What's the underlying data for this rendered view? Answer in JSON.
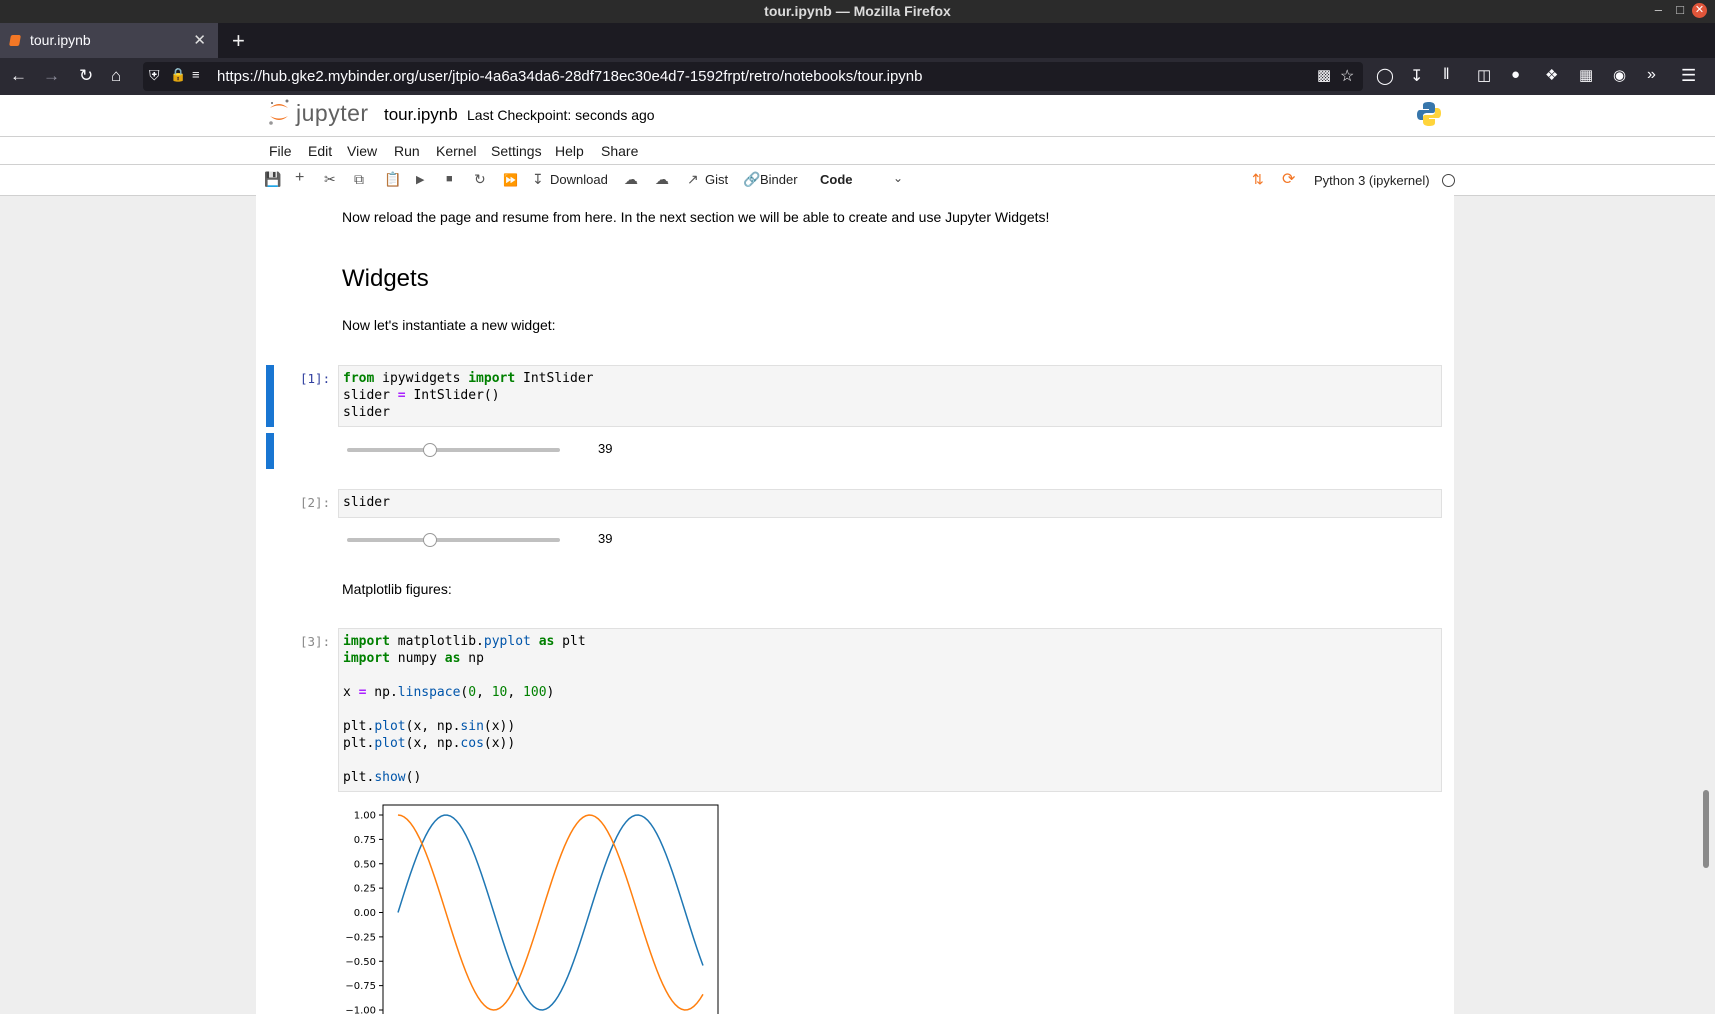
{
  "window": {
    "title": "tour.ipynb — Mozilla Firefox"
  },
  "browser": {
    "tab_title": "tour.ipynb",
    "url": "https://hub.gke2.mybinder.org/user/jtpio-4a6a34da6-28df718ec30e4d7-1592frpt/retro/notebooks/tour.ipynb"
  },
  "jupyter": {
    "logo_text": "jupyter",
    "notebook_name": "tour.ipynb",
    "checkpoint": "Last Checkpoint: seconds ago",
    "menu": [
      "File",
      "Edit",
      "View",
      "Run",
      "Kernel",
      "Settings",
      "Help",
      "Share"
    ],
    "toolbar": {
      "download_label": "Download",
      "gist_label": "Gist",
      "binder_label": "Binder",
      "cell_type": "Code",
      "kernel": "Python 3 (ipykernel)"
    }
  },
  "notebook": {
    "md_reload": "Now reload the page and resume from here. In the next section we will be able to create and use Jupyter Widgets!",
    "h_widgets": "Widgets",
    "md_instantiate": "Now let's instantiate a new widget:",
    "cell1_prompt": "[1]:",
    "cell2_prompt": "[2]:",
    "cell2_code": "slider",
    "slider_value": "39",
    "slider_fraction": 0.39,
    "md_matplotlib": "Matplotlib figures:",
    "cell3_prompt": "[3]:"
  },
  "chart_data": {
    "type": "line",
    "x_range": [
      0,
      10
    ],
    "y_ticks": [
      "1.00",
      "0.75",
      "0.50",
      "0.25",
      "0.00",
      "−0.25",
      "−0.50",
      "−0.75",
      "−1.00"
    ],
    "ylim": [
      -1,
      1
    ],
    "series": [
      {
        "function": "sin(x)",
        "color": "#1f77b4",
        "points": 100
      },
      {
        "function": "cos(x)",
        "color": "#ff7f0e",
        "points": 100
      }
    ]
  }
}
